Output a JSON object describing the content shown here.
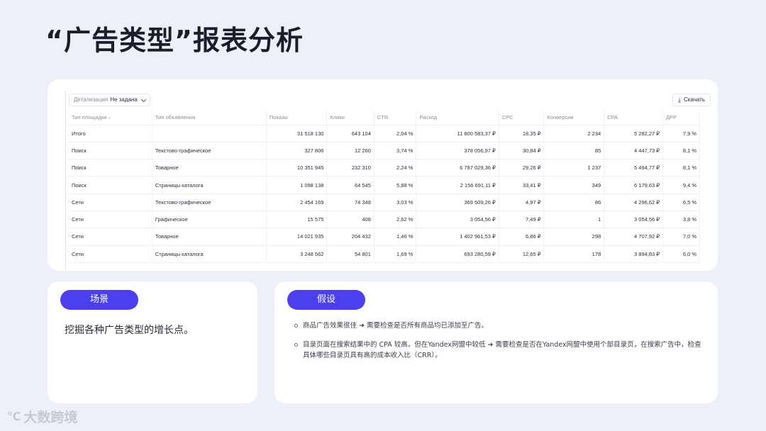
{
  "title": "“广告类型”报表分析",
  "toolbar": {
    "detail_label": "Детализация",
    "detail_value": "Не задана",
    "download_label": "Скачать"
  },
  "table": {
    "columns": [
      "Тип площадки ↓",
      "Тип объявления",
      "Показы",
      "Клики",
      "CTR",
      "Расход",
      "CPC",
      "Конверсии",
      "CPA",
      "ДРР"
    ],
    "rows": [
      [
        "Итого",
        "",
        "31 518 130",
        "643 104",
        "2,04 %",
        "11 800 583,37 ₽",
        "18,35 ₽",
        "2 234",
        "5 282,27 ₽",
        "7,9 %"
      ],
      [
        "Поиск",
        "Текстово-графическое",
        "327 806",
        "12 260",
        "3,74 %",
        "378 056,97 ₽",
        "30,84 ₽",
        "85",
        "4 447,73 ₽",
        "8,1 %"
      ],
      [
        "Поиск",
        "Товарное",
        "10 351 945",
        "232 310",
        "2,24 %",
        "6 797 029,36 ₽",
        "29,26 ₽",
        "1 237",
        "5 494,77 ₽",
        "8,1 %"
      ],
      [
        "Поиск",
        "Страницы каталога",
        "1 098 138",
        "64 545",
        "5,88 %",
        "2 156 691,11 ₽",
        "33,41 ₽",
        "349",
        "6 179,63 ₽",
        "9,4 %"
      ],
      [
        "Сети",
        "Текстово-графическое",
        "2 454 169",
        "74 348",
        "3,03 %",
        "369 509,26 ₽",
        "4,97 ₽",
        "86",
        "4 296,62 ₽",
        "6,5 %"
      ],
      [
        "Сети",
        "Графическое",
        "15 575",
        "408",
        "2,62 %",
        "3 054,56 ₽",
        "7,49 ₽",
        "1",
        "3 054,56 ₽",
        "3,8 %"
      ],
      [
        "Сети",
        "Товарное",
        "14 021 935",
        "204 432",
        "1,46 %",
        "1 402 961,53 ₽",
        "6,86 ₽",
        "298",
        "4 707,92 ₽",
        "7,0 %"
      ],
      [
        "Сети",
        "Страницы каталога",
        "3 248 562",
        "54 801",
        "1,69 %",
        "693 280,59 ₽",
        "12,65 ₽",
        "178",
        "3 894,83 ₽",
        "6,0 %"
      ]
    ]
  },
  "scene": {
    "label": "场景",
    "text": "挖掘各种广告类型的增长点。"
  },
  "hypothesis": {
    "label": "假设",
    "items": [
      "商品广告效果很佳 ➜ 需要检查是否所有商品均已添加至广告。",
      "目录页面在搜索结果中的 CPA 较高，但在Yandex网盟中较低 ➜ 需要检查是否在Yandex网盟中使用个部目录页，在搜索广告中，检查具体哪些目录页具有高的成本收入比（CRR）。"
    ]
  },
  "watermark": "大数跨境"
}
